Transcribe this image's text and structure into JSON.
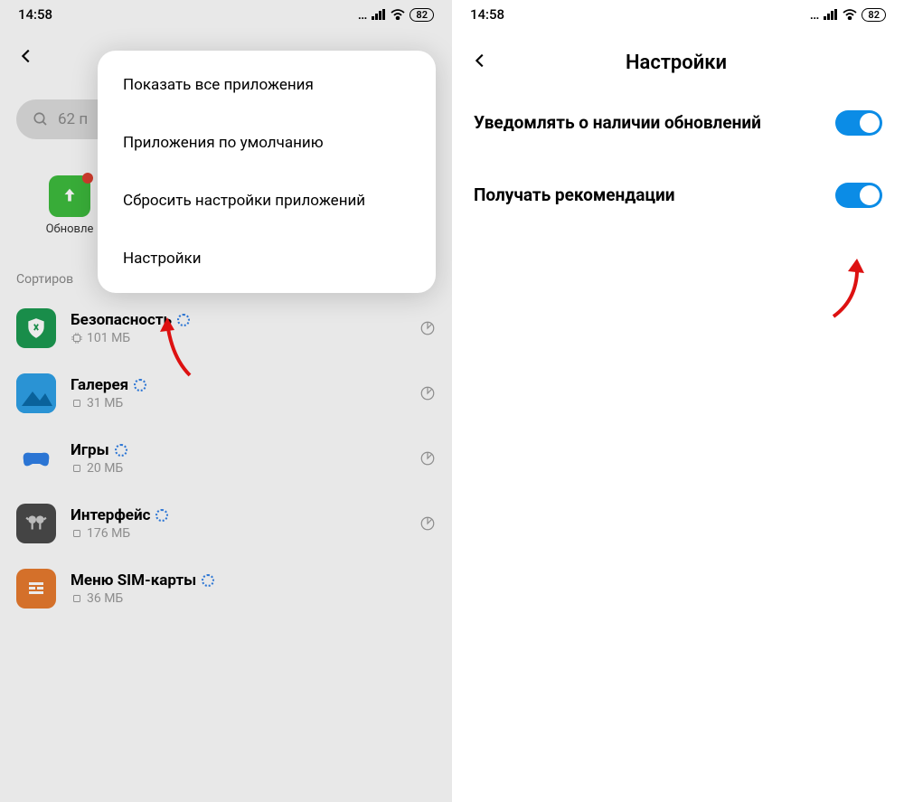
{
  "status": {
    "time": "14:58",
    "battery": "82"
  },
  "left": {
    "search_text": "62 п",
    "update_label": "Обновле",
    "sort_label": "Сортиров",
    "popup": {
      "show_all": "Показать все приложения",
      "default_apps": "Приложения по умолчанию",
      "reset": "Сбросить настройки приложений",
      "settings": "Настройки"
    },
    "apps": [
      {
        "name": "Безопасность",
        "size": "101 МБ"
      },
      {
        "name": "Галерея",
        "size": "31 МБ"
      },
      {
        "name": "Игры",
        "size": "20 МБ"
      },
      {
        "name": "Интерфейс",
        "size": "176 МБ"
      },
      {
        "name": "Меню SIM-карты",
        "size": "36 МБ"
      }
    ]
  },
  "right": {
    "title": "Настройки",
    "notify_updates": "Уведомлять о наличии обновлений",
    "recommendations": "Получать рекомендации"
  }
}
